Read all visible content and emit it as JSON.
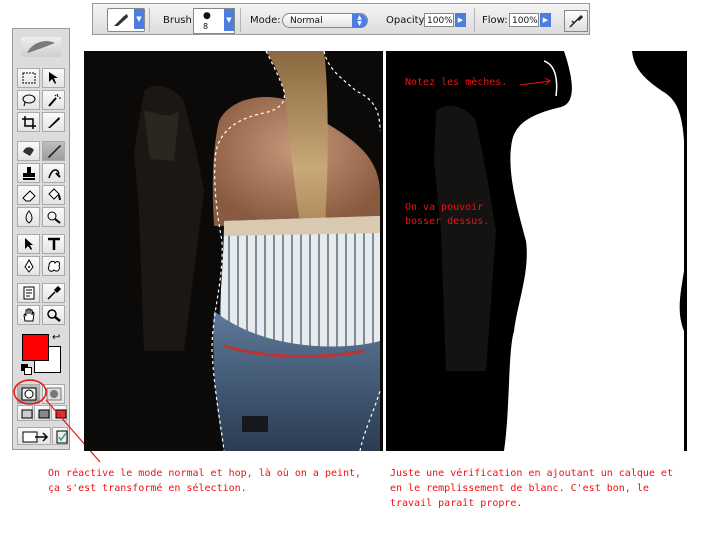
{
  "options_bar": {
    "brush_label": "Brush:",
    "brush_size": "8",
    "mode_label": "Mode:",
    "mode_value": "Normal",
    "opacity_label": "Opacity:",
    "opacity_value": "100%",
    "flow_label": "Flow:",
    "flow_value": "100%"
  },
  "toolbox": {
    "foreground_color": "#ff0000",
    "background_color": "#ffffff",
    "quick_mask_mode": "standard"
  },
  "photo_right": {
    "note_mèches": "Notez les mèches.",
    "note_bosser_line1": "On va pouvoir",
    "note_bosser_line2": "bosser dessus."
  },
  "captions": {
    "left_line1": "On réactive le mode normal et hop, là où on a peint,",
    "left_line2": "ça s'est transformé en sélection.",
    "right_line1": "Juste une vérification en ajoutant un calque et",
    "right_line2": "en le remplissement de blanc. C'est bon, le",
    "right_line3": "travail paraît propre."
  },
  "colors": {
    "annotation_red": "#ee1111",
    "accent_blue": "#4d7de0"
  }
}
